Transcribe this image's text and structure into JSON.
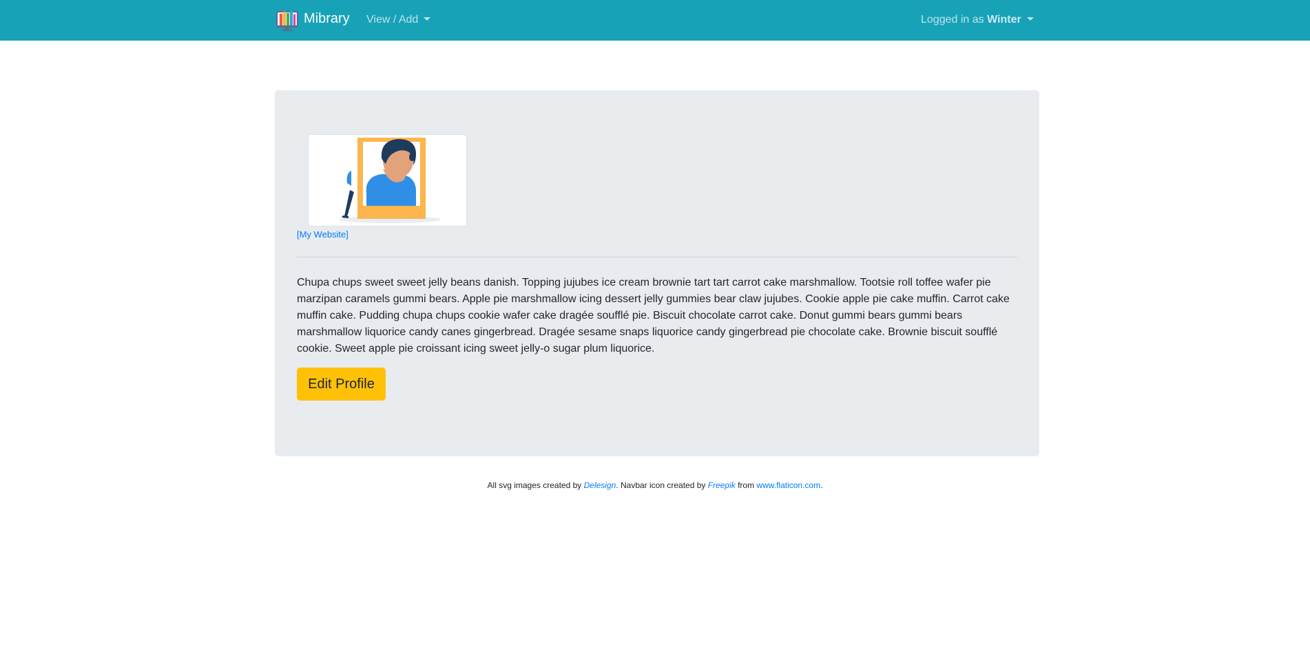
{
  "navbar": {
    "brand": "Mibrary",
    "brand_icon": "books-monitor-icon",
    "view_add": "View / Add",
    "logged_in_prefix": "Logged in as ",
    "username": "Winter",
    "bg_color": "#17a2b8"
  },
  "profile": {
    "avatar_icon": "person-in-frame-illustration",
    "website_link": "[My Website]",
    "bio": "Chupa chups sweet sweet jelly beans danish. Topping jujubes ice cream brownie tart tart carrot cake marshmallow. Tootsie roll toffee wafer pie marzipan caramels gummi bears. Apple pie marshmallow icing dessert jelly gummies bear claw jujubes. Cookie apple pie cake muffin. Carrot cake muffin cake. Pudding chupa chups cookie wafer cake dragée soufflé pie. Biscuit chocolate carrot cake. Donut gummi bears gummi bears marshmallow liquorice candy canes gingerbread. Dragée sesame snaps liquorice candy gingerbread pie chocolate cake. Brownie biscuit soufflé cookie. Sweet apple pie croissant icing sweet jelly-o sugar plum liquorice.",
    "edit_button": "Edit Profile",
    "button_color": "#ffc107",
    "card_color": "#e9ecef"
  },
  "footer": {
    "part1": "All svg images created by ",
    "author1": "Delesign",
    "part2": ". Navbar icon created by ",
    "author2": "Freepik",
    "part3": " from ",
    "site": "www.flaticon.com",
    "part4": ".",
    "link_color": "#007bff"
  }
}
